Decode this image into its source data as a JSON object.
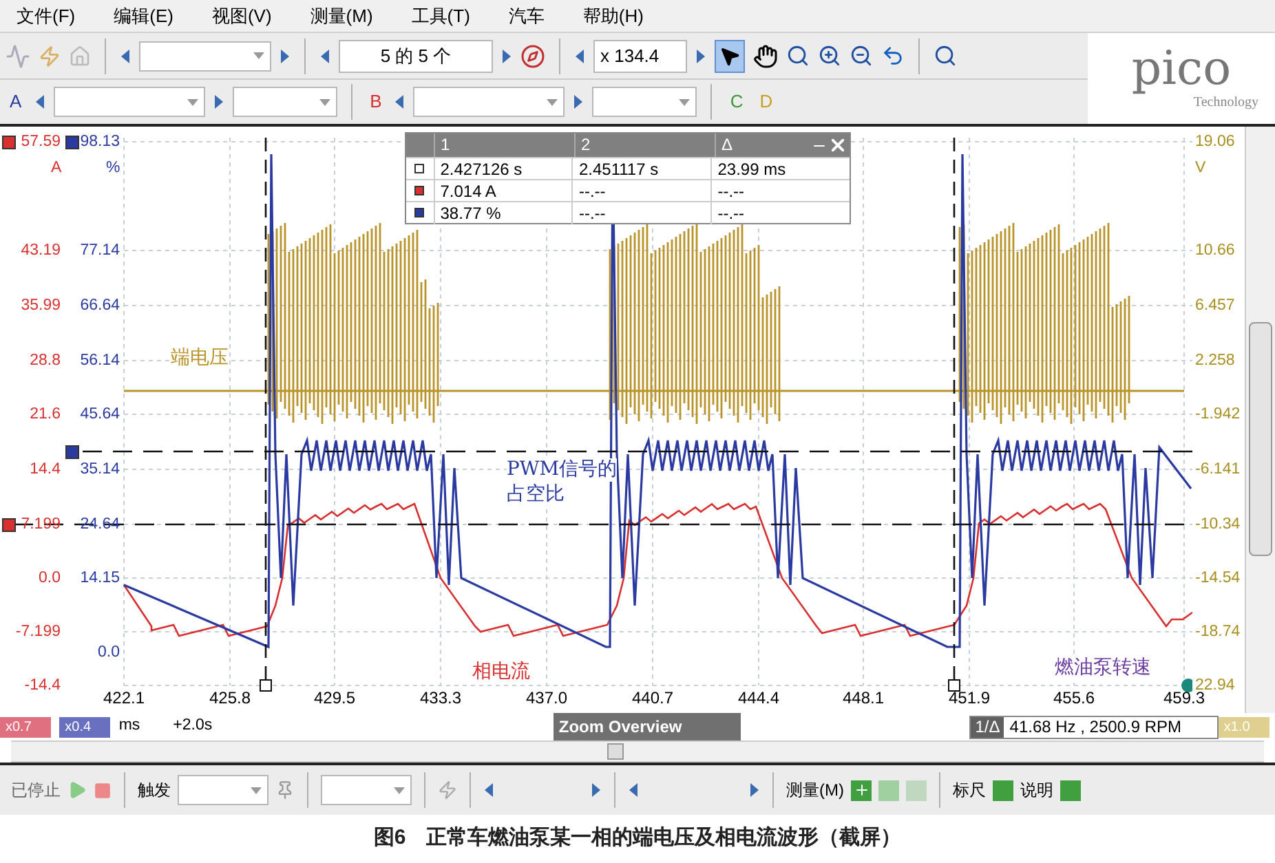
{
  "menu": [
    "文件(F)",
    "编辑(E)",
    "视图(V)",
    "测量(M)",
    "工具(T)",
    "汽车",
    "帮助(H)"
  ],
  "toolbar": {
    "page_counter": "5 的 5 个",
    "zoom_value": "x 134.4"
  },
  "channels": [
    {
      "label": "A",
      "color": "#2a3aa0"
    },
    {
      "label": "B",
      "color": "#d8302f"
    },
    {
      "label": "C",
      "color": "#3a9a3a"
    },
    {
      "label": "D",
      "color": "#c8a020"
    }
  ],
  "logo": {
    "name": "pico",
    "tagline": "Technology"
  },
  "scope": {
    "current_axis": {
      "unit": "A",
      "ticks": [
        "57.59",
        "43.19",
        "35.99",
        "28.8",
        "21.6",
        "14.4",
        "7.199",
        "0.0",
        "-7.199",
        "-14.4"
      ]
    },
    "duty_axis": {
      "unit": "%",
      "ticks": [
        "98.13",
        "77.14",
        "66.64",
        "56.14",
        "45.64",
        "35.14",
        "24.64",
        "14.15",
        "0.0"
      ]
    },
    "voltage_axis": {
      "unit": "V",
      "ticks": [
        "19.06",
        "10.66",
        "6.457",
        "2.258",
        "-1.942",
        "-6.141",
        "-10.34",
        "-14.54",
        "-18.74",
        "22.94"
      ]
    },
    "time_axis": [
      "422.1",
      "425.8",
      "429.5",
      "433.3",
      "437.0",
      "440.7",
      "444.4",
      "448.1",
      "451.9",
      "455.6",
      "459.3"
    ],
    "annotations": [
      {
        "text": "端电压",
        "color": "#b8942a"
      },
      {
        "text": "PWM信号的",
        "color": "#2a3aa0"
      },
      {
        "text": "占空比",
        "color": "#2a3aa0"
      },
      {
        "text": "相电流",
        "color": "#d8302f"
      },
      {
        "text": "燃油泵转速",
        "color": "#6a3aa0"
      }
    ],
    "cursor_table": {
      "columns": [
        "1",
        "2",
        "Δ"
      ],
      "rows": [
        {
          "color": "#ffffff",
          "cells": [
            "2.427126 s",
            "2.451117 s",
            "23.99 ms"
          ]
        },
        {
          "color": "#d8302f",
          "cells": [
            "7.014 A",
            "--.--",
            "--.--"
          ]
        },
        {
          "color": "#2a3aa0",
          "cells": [
            "38.77 %",
            "--.--",
            "--.--"
          ]
        }
      ]
    }
  },
  "status": {
    "scales": [
      {
        "text": "x0.7",
        "color": "#e07080"
      },
      {
        "text": "x0.4",
        "color": "#6a70c0"
      }
    ],
    "unit": "ms",
    "offset": "+2.0s",
    "zoom_overview": "Zoom Overview",
    "measure_label": "1/Δ",
    "measure_value": "41.68 Hz , 2500.9 RPM",
    "right_scale": "x1.0"
  },
  "bottom_toolbar": {
    "stopped": "已停止",
    "trigger": "触发",
    "measure": "测量(M)",
    "ruler": "标尺",
    "notes": "说明"
  },
  "caption": "图6　正常车燃油泵某一相的端电压及相电流波形（截屏）"
}
